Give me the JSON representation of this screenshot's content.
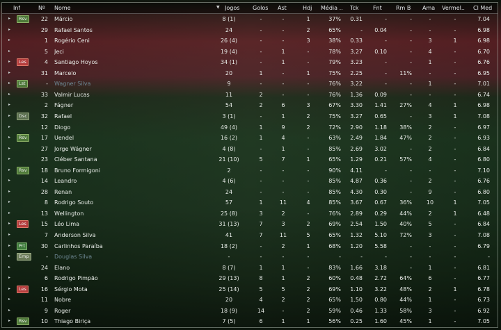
{
  "columns": {
    "inf": "Inf",
    "num": "Nº",
    "nome": "Nome",
    "jogos": "Jogos",
    "golos": "Golos",
    "ast": "Ast",
    "hdj": "Hdj",
    "media": "Média ..",
    "tck": "Tck",
    "fnt": "Fnt",
    "rmb": "Rm B",
    "ama": "Ama",
    "verm": "Vermel..",
    "clmed": "Cl Med"
  },
  "rows": [
    {
      "inf": "Rsv",
      "num": "22",
      "nome": "Márcio",
      "jogos": "8 (1)",
      "golos": "-",
      "ast": "-",
      "hdj": "1",
      "media": "37%",
      "tck": "0.31",
      "fnt": "-",
      "rmb": "-",
      "ama": "-",
      "verm": "-",
      "cl": "7.04"
    },
    {
      "inf": "",
      "num": "29",
      "nome": "Rafael Santos",
      "jogos": "24",
      "golos": "-",
      "ast": "-",
      "hdj": "2",
      "media": "65%",
      "tck": "-",
      "fnt": "0.04",
      "rmb": "-",
      "ama": "-",
      "verm": "-",
      "cl": "6.98"
    },
    {
      "inf": "",
      "num": "1",
      "nome": "Rogério Ceni",
      "jogos": "26 (4)",
      "golos": "-",
      "ast": "-",
      "hdj": "3",
      "media": "38%",
      "tck": "0.33",
      "fnt": "-",
      "rmb": "-",
      "ama": "3",
      "verm": "1",
      "cl": "6.98"
    },
    {
      "inf": "",
      "num": "5",
      "nome": "Jeci",
      "jogos": "19 (4)",
      "golos": "-",
      "ast": "1",
      "hdj": "-",
      "media": "78%",
      "tck": "3.27",
      "fnt": "0.10",
      "rmb": "-",
      "ama": "4",
      "verm": "-",
      "cl": "6.70"
    },
    {
      "inf": "Les",
      "num": "4",
      "nome": "Santiago Hoyos",
      "jogos": "34 (1)",
      "golos": "-",
      "ast": "1",
      "hdj": "-",
      "media": "79%",
      "tck": "3.23",
      "fnt": "-",
      "rmb": "-",
      "ama": "1",
      "verm": "-",
      "cl": "6.76"
    },
    {
      "inf": "",
      "num": "31",
      "nome": "Marcelo",
      "jogos": "20",
      "golos": "1",
      "ast": "-",
      "hdj": "1",
      "media": "75%",
      "tck": "2.25",
      "fnt": "-",
      "rmb": "11%",
      "ama": "-",
      "verm": "-",
      "cl": "6.95"
    },
    {
      "inf": "Lst",
      "num": "-",
      "nome": "Wagner Silva",
      "jogos": "9",
      "golos": "-",
      "ast": "-",
      "hdj": "-",
      "media": "76%",
      "tck": "3.22",
      "fnt": "-",
      "rmb": "-",
      "ama": "1",
      "verm": "-",
      "cl": "7.01",
      "dim": true
    },
    {
      "inf": "",
      "num": "33",
      "nome": "Valmir Lucas",
      "jogos": "11",
      "golos": "2",
      "ast": "-",
      "hdj": "-",
      "media": "76%",
      "tck": "1.36",
      "fnt": "0.09",
      "rmb": "-",
      "ama": "-",
      "verm": "-",
      "cl": "6.74"
    },
    {
      "inf": "",
      "num": "2",
      "nome": "Fágner",
      "jogos": "54",
      "golos": "2",
      "ast": "6",
      "hdj": "3",
      "media": "67%",
      "tck": "3.30",
      "fnt": "1.41",
      "rmb": "27%",
      "ama": "4",
      "verm": "1",
      "cl": "6.98"
    },
    {
      "inf": "Dsc",
      "num": "32",
      "nome": "Rafael",
      "jogos": "3 (1)",
      "golos": "-",
      "ast": "1",
      "hdj": "2",
      "media": "75%",
      "tck": "3.27",
      "fnt": "0.65",
      "rmb": "-",
      "ama": "3",
      "verm": "1",
      "cl": "7.08"
    },
    {
      "inf": "",
      "num": "12",
      "nome": "Diogo",
      "jogos": "49 (4)",
      "golos": "1",
      "ast": "9",
      "hdj": "2",
      "media": "72%",
      "tck": "2.90",
      "fnt": "1.18",
      "rmb": "38%",
      "ama": "2",
      "verm": "-",
      "cl": "6.97"
    },
    {
      "inf": "Rsv",
      "num": "17",
      "nome": "Uendel",
      "jogos": "16 (2)",
      "golos": "1",
      "ast": "4",
      "hdj": "-",
      "media": "63%",
      "tck": "2.49",
      "fnt": "1.84",
      "rmb": "47%",
      "ama": "2",
      "verm": "-",
      "cl": "6.93"
    },
    {
      "inf": "",
      "num": "27",
      "nome": "Jorge Wágner",
      "jogos": "4 (8)",
      "golos": "-",
      "ast": "1",
      "hdj": "-",
      "media": "85%",
      "tck": "2.69",
      "fnt": "3.02",
      "rmb": "-",
      "ama": "2",
      "verm": "-",
      "cl": "6.84"
    },
    {
      "inf": "",
      "num": "23",
      "nome": "Cléber Santana",
      "jogos": "21 (10)",
      "golos": "5",
      "ast": "7",
      "hdj": "1",
      "media": "65%",
      "tck": "1.29",
      "fnt": "0.21",
      "rmb": "57%",
      "ama": "4",
      "verm": "-",
      "cl": "6.80"
    },
    {
      "inf": "Rsv",
      "num": "18",
      "nome": "Bruno Formigoni",
      "jogos": "2",
      "golos": "-",
      "ast": "-",
      "hdj": "-",
      "media": "90%",
      "tck": "4.11",
      "fnt": "-",
      "rmb": "-",
      "ama": "-",
      "verm": "-",
      "cl": "7.10"
    },
    {
      "inf": "",
      "num": "14",
      "nome": "Leandro",
      "jogos": "4 (6)",
      "golos": "-",
      "ast": "-",
      "hdj": "-",
      "media": "85%",
      "tck": "4.87",
      "fnt": "0.36",
      "rmb": "-",
      "ama": "2",
      "verm": "-",
      "cl": "6.76"
    },
    {
      "inf": "",
      "num": "28",
      "nome": "Renan",
      "jogos": "24",
      "golos": "-",
      "ast": "-",
      "hdj": "-",
      "media": "85%",
      "tck": "4.30",
      "fnt": "0.30",
      "rmb": "-",
      "ama": "9",
      "verm": "-",
      "cl": "6.80"
    },
    {
      "inf": "",
      "num": "8",
      "nome": "Rodrigo Souto",
      "jogos": "57",
      "golos": "1",
      "ast": "11",
      "hdj": "4",
      "media": "85%",
      "tck": "3.67",
      "fnt": "0.67",
      "rmb": "36%",
      "ama": "10",
      "verm": "1",
      "cl": "7.05"
    },
    {
      "inf": "",
      "num": "13",
      "nome": "Wellington",
      "jogos": "25 (8)",
      "golos": "3",
      "ast": "2",
      "hdj": "-",
      "media": "76%",
      "tck": "2.89",
      "fnt": "0.29",
      "rmb": "44%",
      "ama": "2",
      "verm": "1",
      "cl": "6.48"
    },
    {
      "inf": "Les",
      "num": "15",
      "nome": "Léo Lima",
      "jogos": "31 (13)",
      "golos": "7",
      "ast": "3",
      "hdj": "2",
      "media": "69%",
      "tck": "2.54",
      "fnt": "1.50",
      "rmb": "40%",
      "ama": "5",
      "verm": "-",
      "cl": "6.84"
    },
    {
      "inf": "",
      "num": "7",
      "nome": "Anderson Silva",
      "jogos": "41",
      "golos": "7",
      "ast": "11",
      "hdj": "5",
      "media": "65%",
      "tck": "1.32",
      "fnt": "5.10",
      "rmb": "72%",
      "ama": "3",
      "verm": "-",
      "cl": "7.08"
    },
    {
      "inf": "Prt",
      "num": "30",
      "nome": "Carlinhos Paraíba",
      "jogos": "18 (2)",
      "golos": "-",
      "ast": "2",
      "hdj": "1",
      "media": "68%",
      "tck": "1.20",
      "fnt": "5.58",
      "rmb": "-",
      "ama": "-",
      "verm": "-",
      "cl": "6.79"
    },
    {
      "inf": "Emp",
      "num": "-",
      "nome": "Douglas Silva",
      "jogos": "-",
      "golos": "-",
      "ast": "-",
      "hdj": "-",
      "media": "-",
      "tck": "-",
      "fnt": "-",
      "rmb": "-",
      "ama": "-",
      "verm": "-",
      "cl": "-",
      "dim": true
    },
    {
      "inf": "",
      "num": "24",
      "nome": "Elano",
      "jogos": "8 (7)",
      "golos": "1",
      "ast": "1",
      "hdj": "-",
      "media": "83%",
      "tck": "1.66",
      "fnt": "3.18",
      "rmb": "-",
      "ama": "1",
      "verm": "-",
      "cl": "6.81"
    },
    {
      "inf": "",
      "num": "6",
      "nome": "Rodrigo Pimpão",
      "jogos": "29 (13)",
      "golos": "8",
      "ast": "1",
      "hdj": "2",
      "media": "60%",
      "tck": "0.48",
      "fnt": "2.72",
      "rmb": "64%",
      "ama": "6",
      "verm": "-",
      "cl": "6.77"
    },
    {
      "inf": "Les",
      "num": "16",
      "nome": "Sérgio Mota",
      "jogos": "25 (14)",
      "golos": "5",
      "ast": "5",
      "hdj": "2",
      "media": "69%",
      "tck": "1.10",
      "fnt": "3.22",
      "rmb": "48%",
      "ama": "2",
      "verm": "1",
      "cl": "6.78"
    },
    {
      "inf": "",
      "num": "11",
      "nome": "Nobre",
      "jogos": "20",
      "golos": "4",
      "ast": "2",
      "hdj": "2",
      "media": "65%",
      "tck": "1.50",
      "fnt": "0.80",
      "rmb": "44%",
      "ama": "1",
      "verm": "-",
      "cl": "6.73"
    },
    {
      "inf": "",
      "num": "9",
      "nome": "Roger",
      "jogos": "18 (9)",
      "golos": "14",
      "ast": "-",
      "hdj": "2",
      "media": "59%",
      "tck": "0.46",
      "fnt": "1.33",
      "rmb": "58%",
      "ama": "3",
      "verm": "-",
      "cl": "6.92"
    },
    {
      "inf": "Rsv",
      "num": "10",
      "nome": "Thiago Biriça",
      "jogos": "7 (5)",
      "golos": "6",
      "ast": "1",
      "hdj": "1",
      "media": "56%",
      "tck": "0.25",
      "fnt": "1.60",
      "rmb": "45%",
      "ama": "1",
      "verm": "-",
      "cl": "7.05"
    }
  ]
}
